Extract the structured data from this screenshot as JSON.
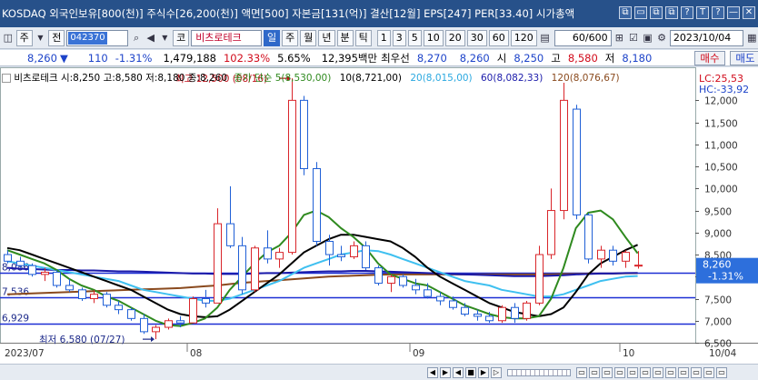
{
  "titlebar": {
    "text": "KOSDAQ 외국인보유[800(천)] 주식수[26,200(천)] 액면[500] 자본금[131(억)] 결산[12월] EPS[247] PER[33.40] 시가총액",
    "controls": [
      "⧉",
      "▭",
      "⧉",
      "⧉",
      "?",
      "T",
      "?",
      "—",
      "▭",
      "✕"
    ]
  },
  "toolbar": {
    "market": "주",
    "board": "전",
    "code": "042370",
    "name": "비츠로테크",
    "periods": [
      "일",
      "주",
      "월",
      "년",
      "분",
      "틱"
    ],
    "selected_period": "일",
    "minutes": [
      "1",
      "3",
      "5",
      "10",
      "20",
      "30",
      "60",
      "120"
    ],
    "count": "60/600",
    "date": "2023/10/04"
  },
  "quote": {
    "price": "8,260",
    "dir": "▼",
    "change": "110",
    "pct": "-1.31%",
    "volume": "1,479,188",
    "vol_ratio": "102.33%",
    "turnover": "5.65%",
    "amount": "12,395백만",
    "prio_label": "최우선",
    "prio_ask": "8,270",
    "prio_bid": "8,260",
    "open_label": "시",
    "open": "8,250",
    "high_label": "고",
    "high": "8,580",
    "low_label": "저",
    "low": "8,180",
    "buy": "매수",
    "sell": "매도"
  },
  "legend": {
    "header": "비츠로테크 시:8,250 고:8,580 저:8,180 종:8,260",
    "ma_label": "종가 단순",
    "ma5": "5(8,530,00)",
    "ma10": "10(8,721,00)",
    "ma20": "20(8,015,00)",
    "ma60": "60(8,082,33)",
    "ma120": "120(8,076,67)",
    "lc": "LC:25,53",
    "hc": "HC:-33,92"
  },
  "colors": {
    "up": "#d9252a",
    "down": "#1f5fd6",
    "ma5": "#2f8a1f",
    "ma10": "#000000",
    "ma20": "#3fc0f0",
    "ma60": "#1a1aaa",
    "ma120": "#8a4a1e",
    "level": "#1c2fd4"
  },
  "chart_data": {
    "type": "candlestick",
    "ylim": [
      6500,
      12750
    ],
    "yticks": [
      "12,000",
      "11,500",
      "11,000",
      "10,500",
      "10,000",
      "9,500",
      "9,000",
      "8,500",
      "8,000",
      "7,500",
      "7,000",
      "6,500"
    ],
    "xlabels": [
      {
        "label": "2023/07",
        "i": 0
      },
      {
        "label": "08",
        "i": 15
      },
      {
        "label": "09",
        "i": 33
      },
      {
        "label": "10",
        "i": 50
      },
      {
        "label": "10/04",
        "i": 53
      }
    ],
    "current_price": 8260,
    "current_price_label": "8,260",
    "current_pct_label": "-1.31%",
    "levels": [
      {
        "value": 8086,
        "label": "8,086"
      },
      {
        "value": 7536,
        "label": "7,536"
      },
      {
        "value": 6929,
        "label": "6,929"
      }
    ],
    "annotations": [
      {
        "text": "최고 12,500 (08/16)",
        "value": 12500,
        "i": 23,
        "side": "left"
      },
      {
        "text": "최저 6,580 (07/27)",
        "value": 6580,
        "i": 12,
        "side": "left"
      }
    ],
    "candles": [
      [
        8500,
        8600,
        8300,
        8350
      ],
      [
        8350,
        8450,
        8200,
        8250
      ],
      [
        8250,
        8300,
        8000,
        8050
      ],
      [
        8050,
        8200,
        7900,
        8100
      ],
      [
        8100,
        8150,
        7750,
        7800
      ],
      [
        7800,
        7950,
        7650,
        7700
      ],
      [
        7700,
        7750,
        7450,
        7500
      ],
      [
        7500,
        7700,
        7400,
        7600
      ],
      [
        7600,
        7650,
        7300,
        7350
      ],
      [
        7350,
        7450,
        7150,
        7250
      ],
      [
        7250,
        7300,
        7000,
        7050
      ],
      [
        7050,
        7150,
        6700,
        6750
      ],
      [
        6750,
        6900,
        6580,
        6850
      ],
      [
        6850,
        7050,
        6800,
        7000
      ],
      [
        7000,
        7100,
        6850,
        6950
      ],
      [
        6950,
        7550,
        6950,
        7500
      ],
      [
        7500,
        7700,
        7300,
        7400
      ],
      [
        7400,
        9550,
        7400,
        9200
      ],
      [
        9200,
        10050,
        8650,
        8700
      ],
      [
        8700,
        8900,
        7600,
        7700
      ],
      [
        7700,
        8700,
        7650,
        8650
      ],
      [
        8650,
        9050,
        8300,
        8400
      ],
      [
        8400,
        8650,
        8200,
        8550
      ],
      [
        8550,
        12500,
        8500,
        12000
      ],
      [
        12000,
        12100,
        10300,
        10450
      ],
      [
        10450,
        10600,
        8700,
        8800
      ],
      [
        8800,
        8950,
        8250,
        8500
      ],
      [
        8500,
        8700,
        8350,
        8450
      ],
      [
        8450,
        8800,
        8400,
        8700
      ],
      [
        8700,
        8800,
        8150,
        8200
      ],
      [
        8200,
        8250,
        7800,
        7850
      ],
      [
        7850,
        8050,
        7650,
        8000
      ],
      [
        8000,
        8050,
        7750,
        7800
      ],
      [
        7800,
        7950,
        7600,
        7700
      ],
      [
        7700,
        7850,
        7500,
        7550
      ],
      [
        7550,
        7650,
        7350,
        7450
      ],
      [
        7450,
        7550,
        7250,
        7300
      ],
      [
        7300,
        7400,
        7100,
        7150
      ],
      [
        7150,
        7250,
        7000,
        7100
      ],
      [
        7100,
        7200,
        6950,
        7000
      ],
      [
        7000,
        7350,
        6950,
        7300
      ],
      [
        7300,
        7400,
        6950,
        7050
      ],
      [
        7050,
        7450,
        7000,
        7400
      ],
      [
        7400,
        8700,
        7350,
        8500
      ],
      [
        8500,
        10000,
        8400,
        9500
      ],
      [
        9500,
        12400,
        9300,
        12000
      ],
      [
        11800,
        11900,
        9300,
        9400
      ],
      [
        9400,
        9450,
        8300,
        8400
      ],
      [
        8400,
        8700,
        8200,
        8600
      ],
      [
        8600,
        8700,
        8250,
        8350
      ],
      [
        8350,
        8600,
        8200,
        8550
      ],
      [
        8250,
        8580,
        8180,
        8260
      ]
    ],
    "series": [
      {
        "name": "5",
        "values": [
          8600,
          8500,
          8400,
          8300,
          8150,
          7950,
          7800,
          7700,
          7550,
          7450,
          7300,
          7150,
          7000,
          6900,
          6880,
          6950,
          7050,
          7300,
          7700,
          8000,
          8300,
          8550,
          8700,
          9000,
          9400,
          9500,
          9350,
          9100,
          8900,
          8650,
          8300,
          8050,
          7950,
          7850,
          7800,
          7650,
          7500,
          7350,
          7250,
          7150,
          7080,
          7050,
          7050,
          7100,
          7500,
          8200,
          9100,
          9450,
          9500,
          9300,
          8900,
          8530
        ]
      },
      {
        "name": "10",
        "values": [
          8650,
          8600,
          8500,
          8400,
          8300,
          8200,
          8100,
          8000,
          7900,
          7800,
          7700,
          7550,
          7400,
          7250,
          7150,
          7100,
          7080,
          7100,
          7250,
          7450,
          7650,
          7850,
          8050,
          8300,
          8550,
          8700,
          8850,
          8950,
          8950,
          8900,
          8850,
          8800,
          8650,
          8450,
          8200,
          8000,
          7850,
          7700,
          7550,
          7400,
          7300,
          7200,
          7150,
          7100,
          7150,
          7300,
          7650,
          8050,
          8300,
          8450,
          8600,
          8721
        ]
      },
      {
        "name": "20",
        "values": [
          8350,
          8300,
          8250,
          8200,
          8150,
          8100,
          8050,
          8000,
          7950,
          7900,
          7800,
          7700,
          7650,
          7600,
          7550,
          7500,
          7450,
          7450,
          7500,
          7600,
          7700,
          7800,
          7900,
          8050,
          8200,
          8300,
          8400,
          8500,
          8550,
          8600,
          8580,
          8500,
          8400,
          8300,
          8200,
          8100,
          8000,
          7900,
          7850,
          7800,
          7700,
          7650,
          7600,
          7550,
          7550,
          7600,
          7700,
          7800,
          7900,
          7950,
          8000,
          8015
        ]
      },
      {
        "name": "60",
        "values": [
          8200,
          8180,
          8170,
          8160,
          8150,
          8150,
          8140,
          8140,
          8130,
          8120,
          8120,
          8110,
          8100,
          8090,
          8080,
          8070,
          8070,
          8060,
          8060,
          8060,
          8070,
          8080,
          8080,
          8090,
          8100,
          8110,
          8120,
          8120,
          8130,
          8130,
          8120,
          8110,
          8100,
          8090,
          8080,
          8070,
          8060,
          8050,
          8040,
          8030,
          8020,
          8010,
          8010,
          8010,
          8020,
          8030,
          8050,
          8060,
          8070,
          8070,
          8080,
          8082
        ]
      },
      {
        "name": "120",
        "values": [
          7600,
          7610,
          7620,
          7630,
          7640,
          7650,
          7660,
          7670,
          7680,
          7690,
          7700,
          7710,
          7720,
          7730,
          7740,
          7760,
          7780,
          7800,
          7830,
          7860,
          7880,
          7900,
          7920,
          7940,
          7960,
          7980,
          8000,
          8010,
          8020,
          8030,
          8040,
          8050,
          8050,
          8050,
          8050,
          8050,
          8050,
          8050,
          8050,
          8050,
          8050,
          8050,
          8050,
          8050,
          8050,
          8060,
          8060,
          8070,
          8070,
          8070,
          8075,
          8077
        ]
      }
    ]
  },
  "bottombar": {
    "controls": [
      "◀",
      "▶",
      "◀",
      "■",
      "▶",
      "▷"
    ]
  }
}
